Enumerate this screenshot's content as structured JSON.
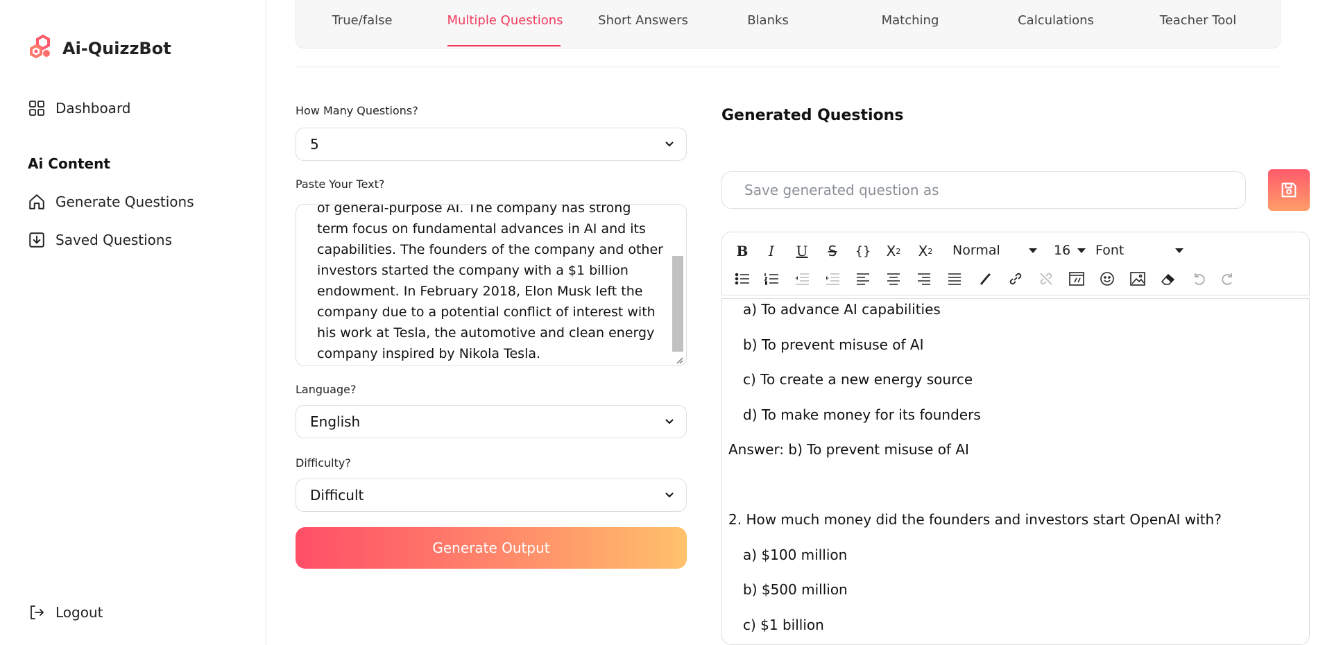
{
  "app": {
    "name": "Ai-QuizzBot"
  },
  "sidebar": {
    "dashboard": "Dashboard",
    "section_title": "Ai Content",
    "generate": "Generate Questions",
    "saved": "Saved Questions",
    "logout": "Logout"
  },
  "tabs": [
    {
      "label": "True/false"
    },
    {
      "label": "Multiple Questions",
      "active": true
    },
    {
      "label": "Short Answers"
    },
    {
      "label": "Blanks"
    },
    {
      "label": "Matching"
    },
    {
      "label": "Calculations"
    },
    {
      "label": "Teacher Tool"
    }
  ],
  "form": {
    "count_label": "How Many Questions?",
    "count_value": "5",
    "text_label": "Paste Your Text?",
    "text_lines": [
      "of general-purpose AI. The company has strong",
      "term focus on fundamental advances in AI and its",
      "capabilities. The founders of the company and other",
      "investors started the company with a $1 billion",
      "endowment. In February 2018, Elon Musk left the",
      "company due to a potential conflict of interest with",
      "his work at Tesla, the automotive and clean energy",
      "company inspired by Nikola Tesla."
    ],
    "language_label": "Language?",
    "language_value": "English",
    "difficulty_label": "Difficulty?",
    "difficulty_value": "Difficult",
    "generate_button": "Generate Output"
  },
  "output": {
    "title": "Generated Questions",
    "save_placeholder": "Save generated question as",
    "toolbar": {
      "heading_select": "Normal",
      "size_select": "16",
      "font_select": "Font"
    },
    "lines": [
      {
        "text": "a) To advance AI capabilities",
        "indent": true
      },
      {
        "text": "b) To prevent misuse of AI",
        "indent": true
      },
      {
        "text": "c) To create a new energy source",
        "indent": true
      },
      {
        "text": "d) To make money for its founders",
        "indent": true
      },
      {
        "text": "Answer: b) To prevent misuse of AI",
        "indent": false
      },
      {
        "text": "",
        "indent": false
      },
      {
        "text": "2. How much money did the founders and investors start OpenAI with?",
        "indent": false
      },
      {
        "text": "a) $100 million",
        "indent": true
      },
      {
        "text": "b) $500 million",
        "indent": true
      },
      {
        "text": "c) $1 billion",
        "indent": true
      }
    ]
  },
  "colors": {
    "accent": "#f23a5c",
    "gradient_start": "#ff4e68",
    "gradient_end": "#ffc26b"
  }
}
